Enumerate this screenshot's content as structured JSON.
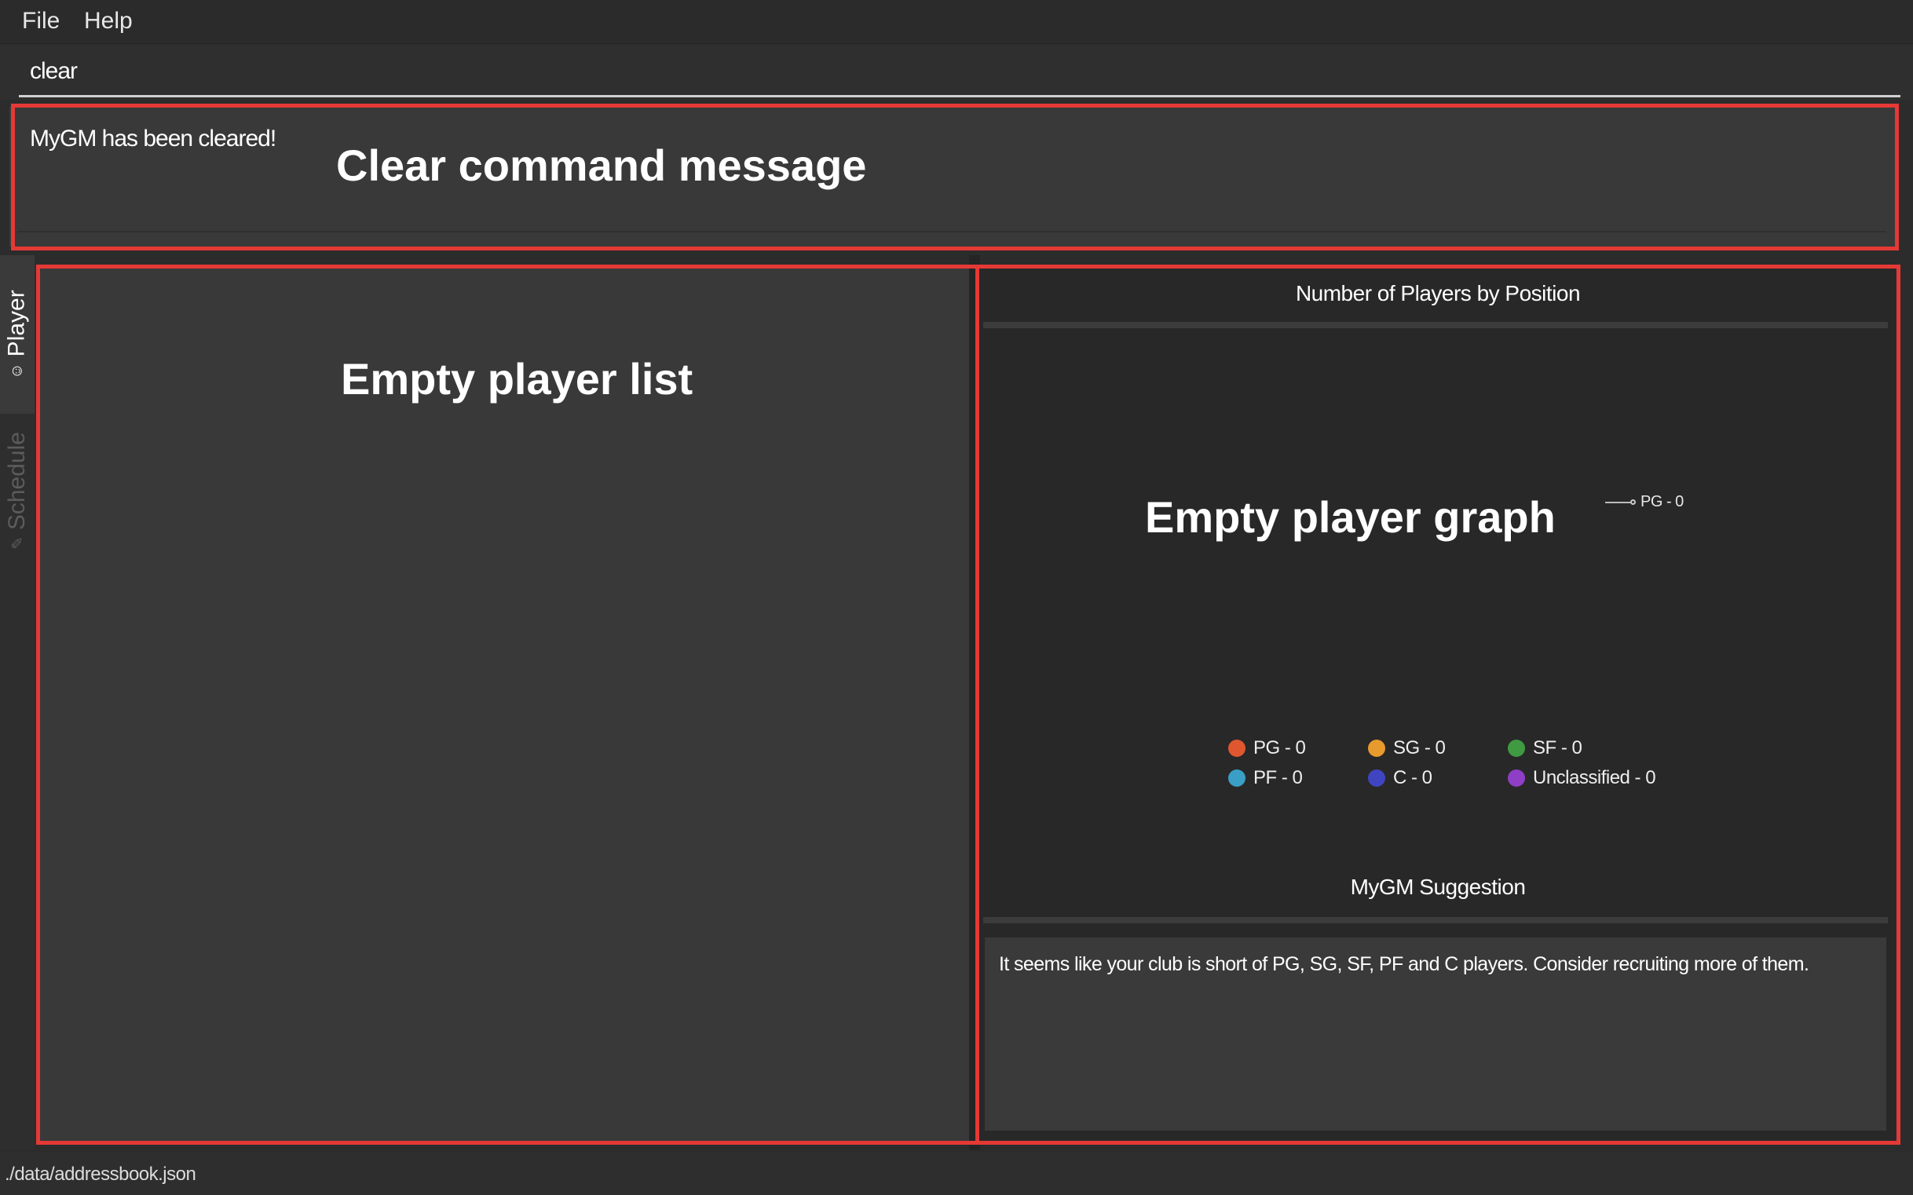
{
  "menu": {
    "file": "File",
    "help": "Help"
  },
  "command": {
    "value": "clear"
  },
  "result": {
    "message": "MyGM has been cleared!"
  },
  "tabs": [
    {
      "label": "Player",
      "icon": "smiley-icon",
      "active": true
    },
    {
      "label": "Schedule",
      "icon": "edit-icon",
      "active": false
    }
  ],
  "graph": {
    "title": "Number of Players by Position",
    "pie_label": "PG - 0",
    "legend": [
      {
        "label": "PG - 0",
        "color": "#e0572f"
      },
      {
        "label": "SG - 0",
        "color": "#e89a2c"
      },
      {
        "label": "SF - 0",
        "color": "#3f9a42"
      },
      {
        "label": "PF - 0",
        "color": "#3a9fc6"
      },
      {
        "label": "C - 0",
        "color": "#3f45c0"
      },
      {
        "label": "Unclassified - 0",
        "color": "#8f3ec6"
      }
    ]
  },
  "suggestion": {
    "title": "MyGM Suggestion",
    "text": "It seems like your club is short of PG, SG, SF, PF and C players. Consider recruiting more of them."
  },
  "status": {
    "path": "./data/addressbook.json"
  },
  "annotations": {
    "clear_message": "Clear command message",
    "player_list": "Empty player list",
    "player_graph": "Empty player graph",
    "color": "#e53935"
  },
  "chart_data": {
    "type": "pie",
    "title": "Number of Players by Position",
    "categories": [
      "PG",
      "SG",
      "SF",
      "PF",
      "C",
      "Unclassified"
    ],
    "values": [
      0,
      0,
      0,
      0,
      0,
      0
    ],
    "legend": "bottom"
  }
}
